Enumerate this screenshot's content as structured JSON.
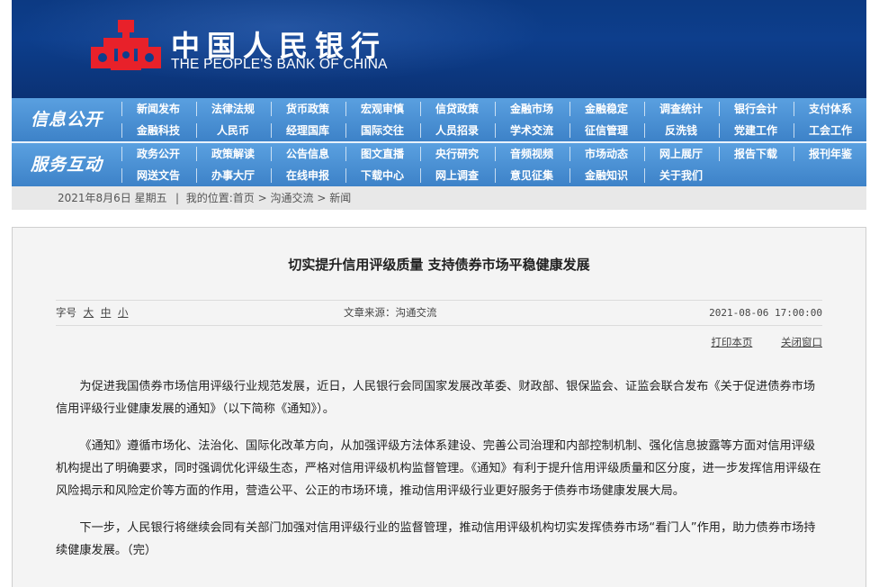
{
  "header": {
    "bank_name_cn": "中国人民银行",
    "bank_name_en": "THE PEOPLE'S BANK OF CHINA",
    "logo_icon": "pboc-logo-icon",
    "colors": {
      "banner": "#0d3e8c",
      "nav": "#4c90d4",
      "logo": "#e8212a"
    }
  },
  "nav": {
    "info_label": "信息公开",
    "service_label": "服务互动",
    "info_row1": [
      "新闻发布",
      "法律法规",
      "货币政策",
      "宏观审慎",
      "信贷政策",
      "金融市场",
      "金融稳定",
      "调查统计",
      "银行会计",
      "支付体系"
    ],
    "info_row2": [
      "金融科技",
      "人民币",
      "经理国库",
      "国际交往",
      "人员招录",
      "学术交流",
      "征信管理",
      "反洗钱",
      "党建工作",
      "工会工作"
    ],
    "service_row1": [
      "政务公开",
      "政策解读",
      "公告信息",
      "图文直播",
      "央行研究",
      "音频视频",
      "市场动态",
      "网上展厅",
      "报告下载",
      "报刊年鉴"
    ],
    "service_row2": [
      "网送文告",
      "办事大厅",
      "在线申报",
      "下载中心",
      "网上调查",
      "意见征集",
      "金融知识",
      "关于我们"
    ]
  },
  "breadcrumb": {
    "date": "2021年8月6日  星期五",
    "separator": "|",
    "prefix": "我的位置:",
    "items": [
      "首页",
      "沟通交流",
      "新闻"
    ],
    "arrow": ">"
  },
  "article": {
    "title": "切实提升信用评级质量  支持债券市场平稳健康发展",
    "font_size_label": "字号",
    "font_sizes": [
      "大",
      "中",
      "小"
    ],
    "source": "文章来源：沟通交流",
    "time": "2021-08-06  17:00:00",
    "print_label": "打印本页",
    "close_label": "关闭窗口",
    "paragraphs": [
      "为促进我国债券市场信用评级行业规范发展，近日，人民银行会同国家发展改革委、财政部、银保监会、证监会联合发布《关于促进债券市场信用评级行业健康发展的通知》（以下简称《通知》）。",
      "《通知》遵循市场化、法治化、国际化改革方向，从加强评级方法体系建设、完善公司治理和内部控制机制、强化信息披露等方面对信用评级机构提出了明确要求，同时强调优化评级生态，严格对信用评级机构监督管理。《通知》有利于提升信用评级质量和区分度，进一步发挥信用评级在风险揭示和风险定价等方面的作用，营造公平、公正的市场环境，推动信用评级行业更好服务于债券市场健康发展大局。",
      "下一步，人民银行将继续会同有关部门加强对信用评级行业的监督管理，推动信用评级机构切实发挥债券市场“看门人”作用，助力债券市场持续健康发展。（完）"
    ]
  }
}
